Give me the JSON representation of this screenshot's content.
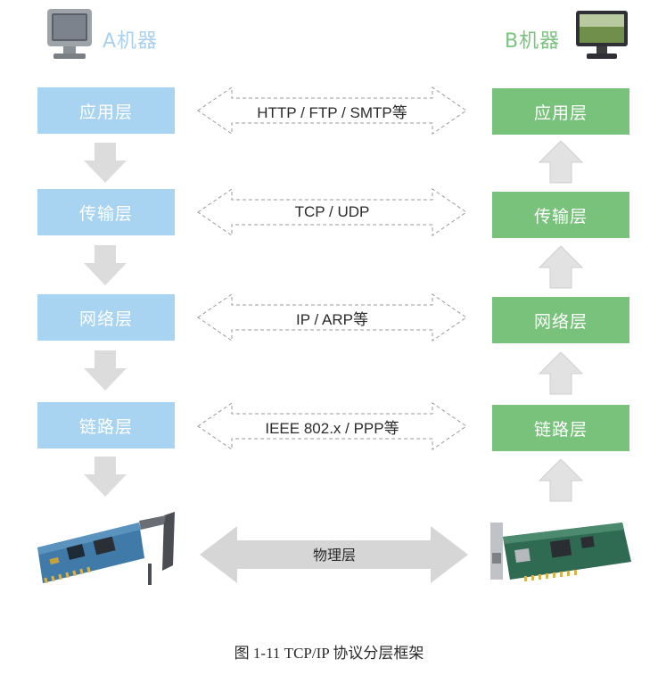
{
  "machine_a": {
    "label": "A机器",
    "label_color": "#a9d0ef"
  },
  "machine_b": {
    "label": "B机器",
    "label_color": "#7cc37f"
  },
  "layers_a": [
    "应用层",
    "传输层",
    "网络层",
    "链路层"
  ],
  "layers_b": [
    "应用层",
    "传输层",
    "网络层",
    "链路层"
  ],
  "protocols": [
    "HTTP / FTP / SMTP等",
    "TCP / UDP",
    "IP / ARP等",
    "IEEE 802.x / PPP等"
  ],
  "physical_layer": "物理层",
  "caption": "图 1-11   TCP/IP 协议分层框架",
  "colors": {
    "a_layer": "#a8d4f2",
    "b_layer": "#78c27c",
    "arrow": "#dcdcdc",
    "phys_arrow": "#d6d6d6"
  },
  "icons": {
    "machine_a": "computer-monitor-icon",
    "machine_b": "computer-monitor-icon",
    "nic_a": "network-card-icon",
    "nic_b": "network-card-icon"
  }
}
